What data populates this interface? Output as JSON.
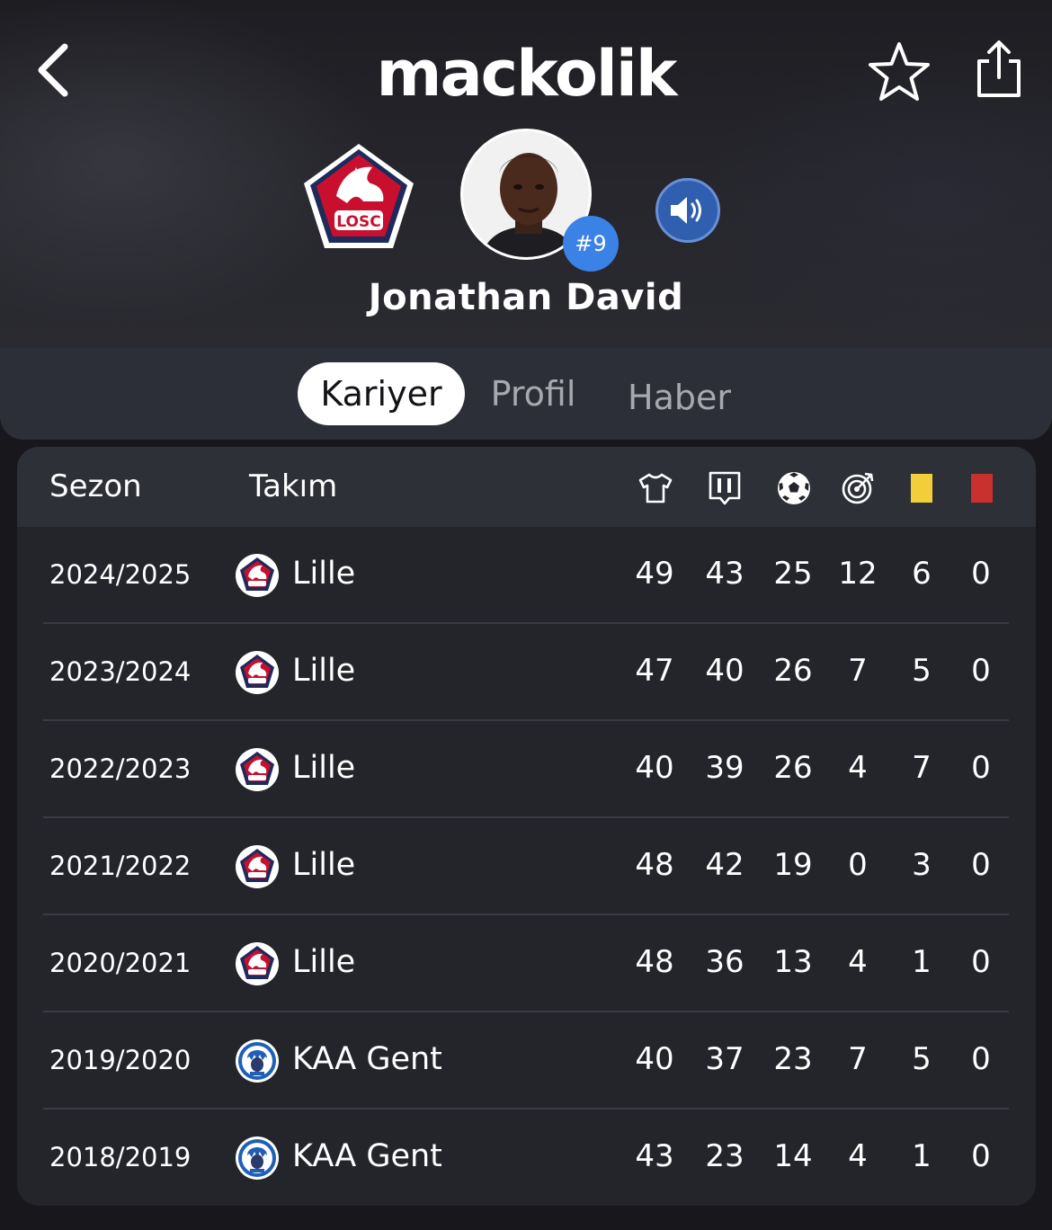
{
  "header": {
    "app_name": "mackolik",
    "player_name": "Jonathan David",
    "jersey_number": "#9",
    "club_crest_text": "LOSC"
  },
  "tabs": [
    {
      "label": "Kariyer",
      "active": true
    },
    {
      "label": "Profil",
      "active": false
    },
    {
      "label": "Haber",
      "active": false
    }
  ],
  "table": {
    "columns": {
      "season": "Sezon",
      "team": "Takım",
      "stat_icons": [
        "jersey-icon",
        "starting-eleven-icon",
        "football-icon",
        "assist-target-icon",
        "yellow-card-icon",
        "red-card-icon"
      ]
    },
    "rows": [
      {
        "season": "2024/2025",
        "team": "Lille",
        "crest": "losc",
        "stats": [
          "49",
          "43",
          "25",
          "12",
          "6",
          "0"
        ]
      },
      {
        "season": "2023/2024",
        "team": "Lille",
        "crest": "losc",
        "stats": [
          "47",
          "40",
          "26",
          "7",
          "5",
          "0"
        ]
      },
      {
        "season": "2022/2023",
        "team": "Lille",
        "crest": "losc",
        "stats": [
          "40",
          "39",
          "26",
          "4",
          "7",
          "0"
        ]
      },
      {
        "season": "2021/2022",
        "team": "Lille",
        "crest": "losc",
        "stats": [
          "48",
          "42",
          "19",
          "0",
          "3",
          "0"
        ]
      },
      {
        "season": "2020/2021",
        "team": "Lille",
        "crest": "losc",
        "stats": [
          "48",
          "36",
          "13",
          "4",
          "1",
          "0"
        ]
      },
      {
        "season": "2019/2020",
        "team": "KAA Gent",
        "crest": "gent",
        "stats": [
          "40",
          "37",
          "23",
          "7",
          "5",
          "0"
        ]
      },
      {
        "season": "2018/2019",
        "team": "KAA Gent",
        "crest": "gent",
        "stats": [
          "43",
          "23",
          "14",
          "4",
          "1",
          "0"
        ]
      }
    ]
  },
  "colors": {
    "background": "#17171c",
    "accent_blue": "#3b82e6",
    "yellow_card": "#f2cf3a",
    "red_card": "#c8312e",
    "losc_red": "#c8102e",
    "losc_navy": "#1d2a5b"
  }
}
